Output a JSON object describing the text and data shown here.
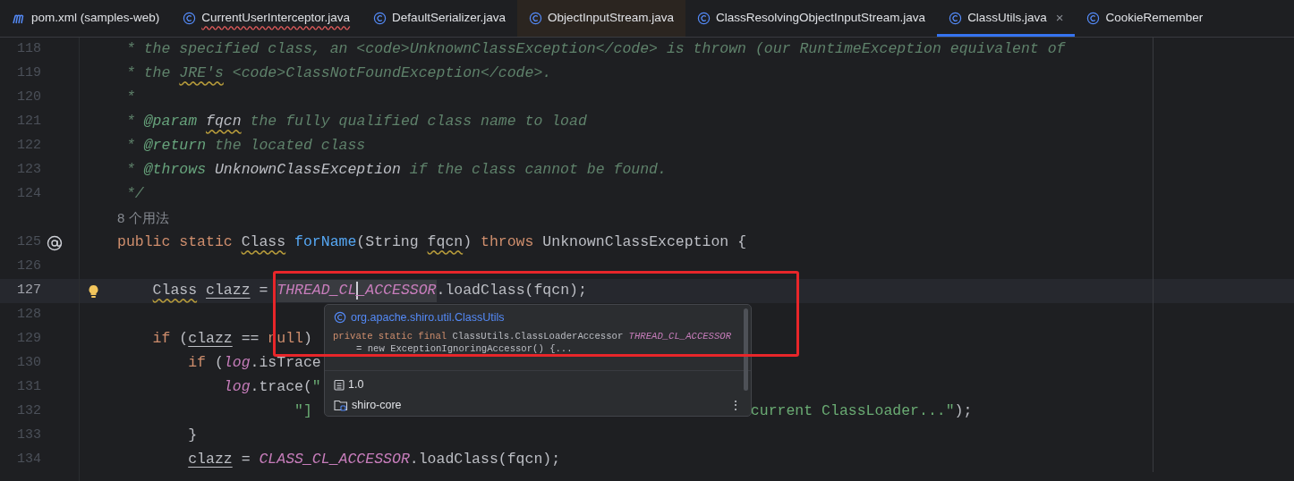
{
  "tabs": [
    {
      "label": "pom.xml (samples-web)",
      "kind": "maven",
      "selected": false,
      "error": false,
      "highlighted": false
    },
    {
      "label": "CurrentUserInterceptor.java",
      "kind": "class",
      "selected": false,
      "error": true,
      "highlighted": false
    },
    {
      "label": "DefaultSerializer.java",
      "kind": "class",
      "selected": false,
      "error": false,
      "highlighted": false
    },
    {
      "label": "ObjectInputStream.java",
      "kind": "class",
      "selected": false,
      "error": false,
      "highlighted": true
    },
    {
      "label": "ClassResolvingObjectInputStream.java",
      "kind": "class",
      "selected": false,
      "error": false,
      "highlighted": false
    },
    {
      "label": "ClassUtils.java",
      "kind": "class",
      "selected": true,
      "error": false,
      "highlighted": false,
      "close": "×"
    },
    {
      "label": "CookieRemember",
      "kind": "class",
      "selected": false,
      "error": false,
      "highlighted": false
    }
  ],
  "editor": {
    "lines": [
      {
        "kind": "code",
        "number": "118",
        "current": false,
        "segments": [
          {
            "text": " * the specified class, an <code>UnknownClassException</code> is thrown (our RuntimeException equivalent of",
            "kind": "comment"
          }
        ]
      },
      {
        "kind": "code",
        "number": "119",
        "current": false,
        "segments": [
          {
            "text": " * the ",
            "kind": "comment"
          },
          {
            "text": "JRE's",
            "kind": "comment",
            "squiggle": true
          },
          {
            "text": " <code>ClassNotFoundException</code>.",
            "kind": "comment"
          }
        ]
      },
      {
        "kind": "code",
        "number": "120",
        "current": false,
        "segments": [
          {
            "text": " *",
            "kind": "comment"
          }
        ]
      },
      {
        "kind": "code",
        "number": "121",
        "current": false,
        "segments": [
          {
            "text": " * ",
            "kind": "comment"
          },
          {
            "text": "@param",
            "kind": "doctag"
          },
          {
            "text": " fqcn",
            "kind": "docref",
            "squiggle": true
          },
          {
            "text": " the fully qualified class name to load",
            "kind": "comment"
          }
        ]
      },
      {
        "kind": "code",
        "number": "122",
        "current": false,
        "segments": [
          {
            "text": " * ",
            "kind": "comment"
          },
          {
            "text": "@return",
            "kind": "doctag"
          },
          {
            "text": " the located class",
            "kind": "comment"
          }
        ]
      },
      {
        "kind": "code",
        "number": "123",
        "current": false,
        "segments": [
          {
            "text": " * ",
            "kind": "comment"
          },
          {
            "text": "@throws",
            "kind": "doctag"
          },
          {
            "text": " UnknownClassException",
            "kind": "docref"
          },
          {
            "text": " if the class cannot be found.",
            "kind": "comment"
          }
        ]
      },
      {
        "kind": "code",
        "number": "124",
        "current": false,
        "segments": [
          {
            "text": " */",
            "kind": "comment"
          }
        ]
      },
      {
        "kind": "inlay",
        "text": "8 个用法"
      },
      {
        "kind": "code",
        "number": "125",
        "current": false,
        "overridden": true,
        "segments": [
          {
            "text": "public static ",
            "kind": "keyword"
          },
          {
            "text": "Class",
            "kind": "plain",
            "squiggle": true
          },
          {
            "text": " forName",
            "kind": "fn"
          },
          {
            "text": "(String ",
            "kind": "plain"
          },
          {
            "text": "fqcn",
            "kind": "plain",
            "squiggle": true
          },
          {
            "text": ") ",
            "kind": "plain"
          },
          {
            "text": "throws",
            "kind": "keyword"
          },
          {
            "text": " UnknownClassException {",
            "kind": "plain"
          }
        ]
      },
      {
        "kind": "code",
        "number": "126",
        "current": false
      },
      {
        "kind": "code",
        "number": "127",
        "current": true,
        "intention": true,
        "segments": [
          {
            "text": "    Class",
            "kind": "plain",
            "squiggle": true
          },
          {
            "text": " clazz",
            "kind": "var"
          },
          {
            "text": " = ",
            "kind": "plain"
          },
          {
            "text": "THREAD_CL",
            "kind": "const",
            "hovered": true
          },
          {
            "text": "_ACCESSOR",
            "kind": "const",
            "hovered": true,
            "caret_before": true
          },
          {
            "text": ".loadClass(fqcn);",
            "kind": "plain"
          }
        ]
      },
      {
        "kind": "code",
        "number": "128",
        "current": false
      },
      {
        "kind": "code",
        "number": "129",
        "current": false,
        "segments": [
          {
            "text": "    if",
            "kind": "keyword"
          },
          {
            "text": " (",
            "kind": "plain"
          },
          {
            "text": "clazz",
            "kind": "var"
          },
          {
            "text": " == ",
            "kind": "plain"
          },
          {
            "text": "null",
            "kind": "keyword"
          },
          {
            "text": ")",
            "kind": "plain"
          }
        ]
      },
      {
        "kind": "code",
        "number": "130",
        "current": false,
        "segments": [
          {
            "text": "        if",
            "kind": "keyword"
          },
          {
            "text": " (",
            "kind": "plain"
          },
          {
            "text": "log",
            "kind": "const"
          },
          {
            "text": ".isTrace",
            "kind": "plain"
          }
        ]
      },
      {
        "kind": "code",
        "number": "131",
        "current": false,
        "segments": [
          {
            "text": "            log",
            "kind": "const"
          },
          {
            "text": ".trace(",
            "kind": "plain"
          },
          {
            "text": "\"",
            "kind": "string"
          }
        ]
      },
      {
        "kind": "code",
        "number": "132",
        "current": false,
        "segments": [
          {
            "text": "                    \"]",
            "kind": "string"
          },
          {
            "text": "current ClassLoader...\"",
            "kind": "string",
            "gap_before": true
          },
          {
            "text": ");",
            "kind": "plain"
          }
        ]
      },
      {
        "kind": "code",
        "number": "133",
        "current": false,
        "segments": [
          {
            "text": "        }",
            "kind": "plain"
          }
        ]
      },
      {
        "kind": "code",
        "number": "134",
        "current": false,
        "segments": [
          {
            "text": "        clazz",
            "kind": "var"
          },
          {
            "text": " = ",
            "kind": "plain"
          },
          {
            "text": "CLASS_CL_ACCESSOR",
            "kind": "const"
          },
          {
            "text": ".loadClass(fqcn);",
            "kind": "plain"
          }
        ]
      }
    ]
  },
  "popup": {
    "class_name": "org.apache.shiro.util.ClassUtils",
    "signature": [
      {
        "text": "private static final ",
        "kind": "keyword"
      },
      {
        "text": "ClassUtils.ClassLoaderAccessor ",
        "kind": "plain"
      },
      {
        "text": "THREAD_CL_ACCESSOR",
        "kind": "const"
      }
    ],
    "signature_continued": "= new ExceptionIgnoringAccessor() {...",
    "since": "1.0",
    "module": "shiro-core",
    "more": "⋮"
  },
  "annotation": {
    "kind": "rectangle",
    "color": "#e8262a"
  }
}
